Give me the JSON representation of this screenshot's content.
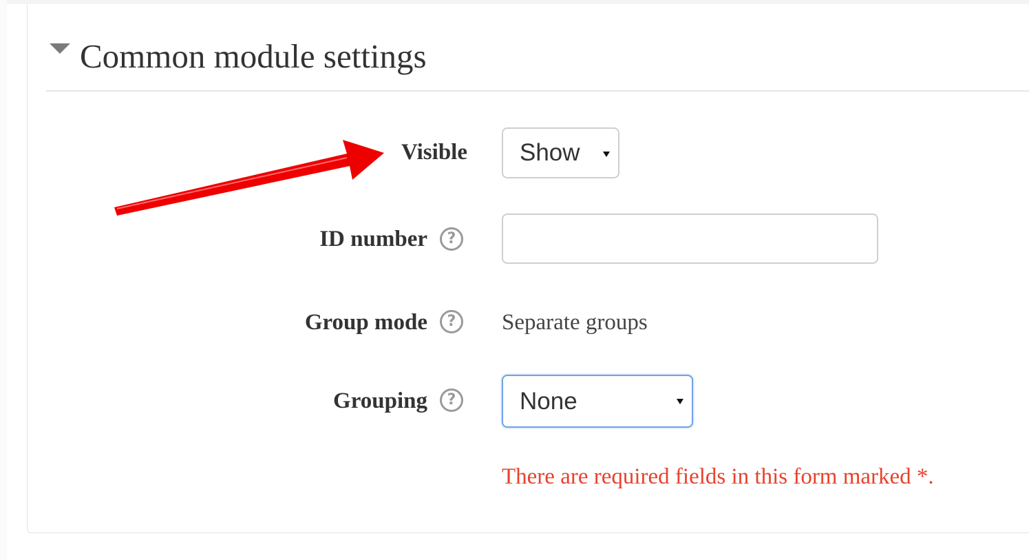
{
  "section": {
    "title": "Common module settings"
  },
  "fields": {
    "visible": {
      "label": "Visible",
      "value": "Show"
    },
    "id_number": {
      "label": "ID number",
      "value": ""
    },
    "group_mode": {
      "label": "Group mode",
      "value": "Separate groups"
    },
    "grouping": {
      "label": "Grouping",
      "value": "None"
    }
  },
  "required_note": "There are required fields in this form marked *.",
  "icons": {
    "section_toggle": "caret-down-icon",
    "help": "question-circle-icon",
    "annotation": "red-arrow-annotation"
  },
  "colors": {
    "error_text": "#e8412d",
    "annotation_arrow": "#ee0000",
    "focus_border": "#6fa3e6"
  }
}
